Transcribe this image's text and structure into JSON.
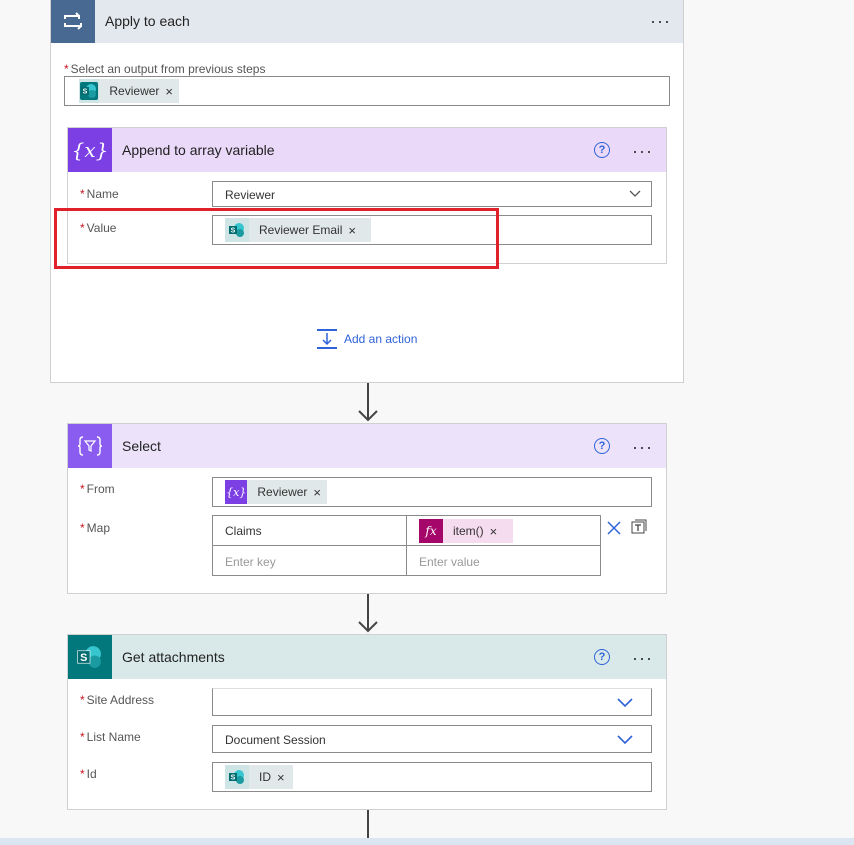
{
  "apply_each": {
    "title": "Apply to each",
    "select_label": "Select an output from previous steps",
    "token": "Reviewer"
  },
  "append": {
    "title": "Append to array variable",
    "name_label": "Name",
    "name_value": "Reviewer",
    "value_label": "Value",
    "value_token": "Reviewer Email"
  },
  "add_action": {
    "label": "Add an action"
  },
  "select": {
    "title": "Select",
    "from_label": "From",
    "from_token": "Reviewer",
    "map_label": "Map",
    "map_key": "Claims",
    "map_value_token": "item()",
    "key_placeholder": "Enter key",
    "value_placeholder": "Enter value"
  },
  "get_attachments": {
    "title": "Get attachments",
    "site_label": "Site Address",
    "list_label": "List Name",
    "list_value": "Document Session",
    "id_label": "Id",
    "id_token": "ID"
  },
  "glyphs": {
    "more": "···",
    "help": "?",
    "remove": "×",
    "fx": "fx",
    "var": "{x}"
  },
  "colors": {
    "variable_purple": "#7b3fe4",
    "select_purple": "#8a5cf0",
    "sharepoint_teal": "#03787c",
    "expression_magenta": "#a4066a",
    "highlight_red": "#e0202a",
    "link_blue": "#2f63d8"
  }
}
